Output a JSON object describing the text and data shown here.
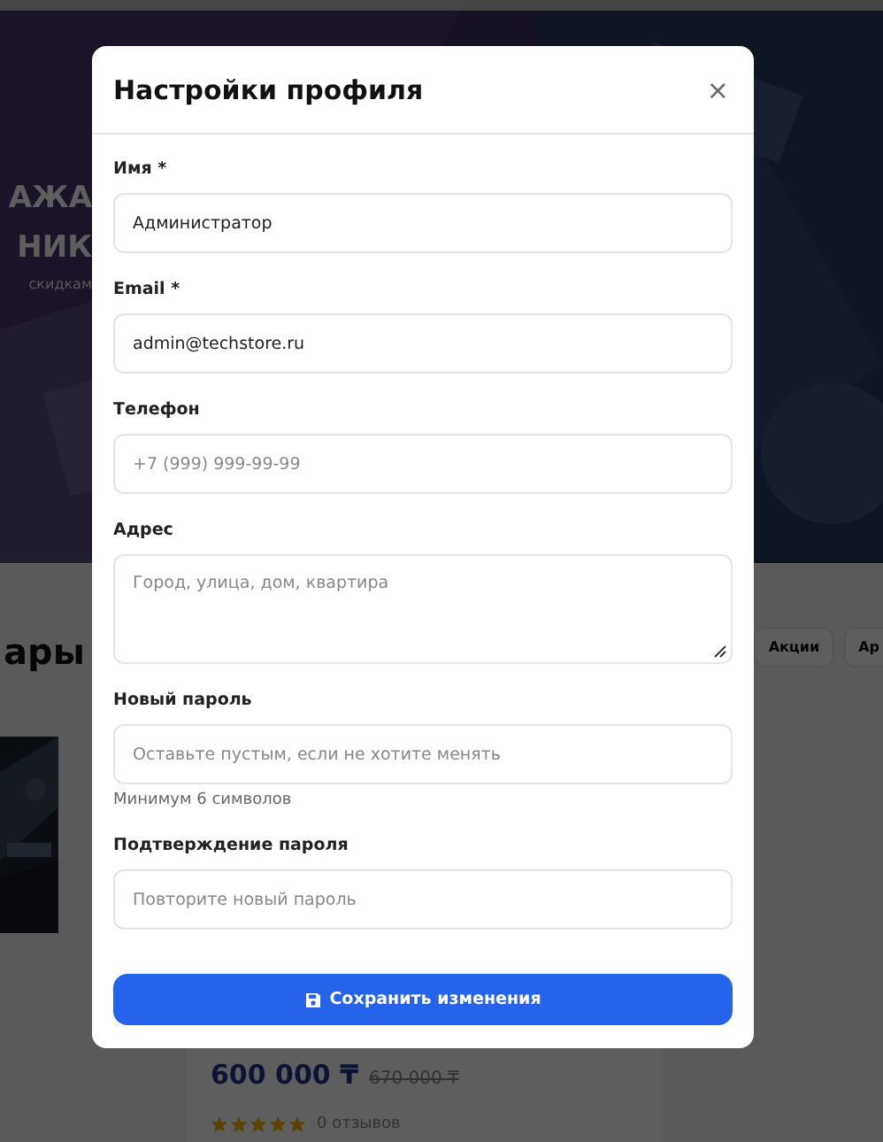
{
  "background": {
    "hero_lines": [
      "АЖА",
      "НИК",
      "скидкам"
    ],
    "section_title": "ары",
    "filters": [
      "Акции",
      "Ар"
    ],
    "product": {
      "price": "600 000 ₸",
      "old_price": "670 000 ₸",
      "stars": 5,
      "reviews": "0 отзывов"
    }
  },
  "modal": {
    "title": "Настройки профиля",
    "close": "×",
    "fields": [
      {
        "label": "Имя *",
        "kind": "input",
        "value": "Администратор"
      },
      {
        "label": "Email *",
        "kind": "input",
        "value": "admin@techstore.ru"
      },
      {
        "label": "Телефон",
        "kind": "input",
        "placeholder": "+7 (999) 999-99-99"
      },
      {
        "label": "Адрес",
        "kind": "textarea",
        "placeholder": "Город, улица, дом, квартира"
      },
      {
        "label": "Новый пароль",
        "kind": "input",
        "placeholder": "Оставьте пустым, если не хотите менять",
        "hint": "Минимум 6 символов"
      },
      {
        "label": "Подтверждение пароля",
        "kind": "input",
        "placeholder": "Повторите новый пароль"
      }
    ],
    "save_button": "Сохранить изменения"
  }
}
